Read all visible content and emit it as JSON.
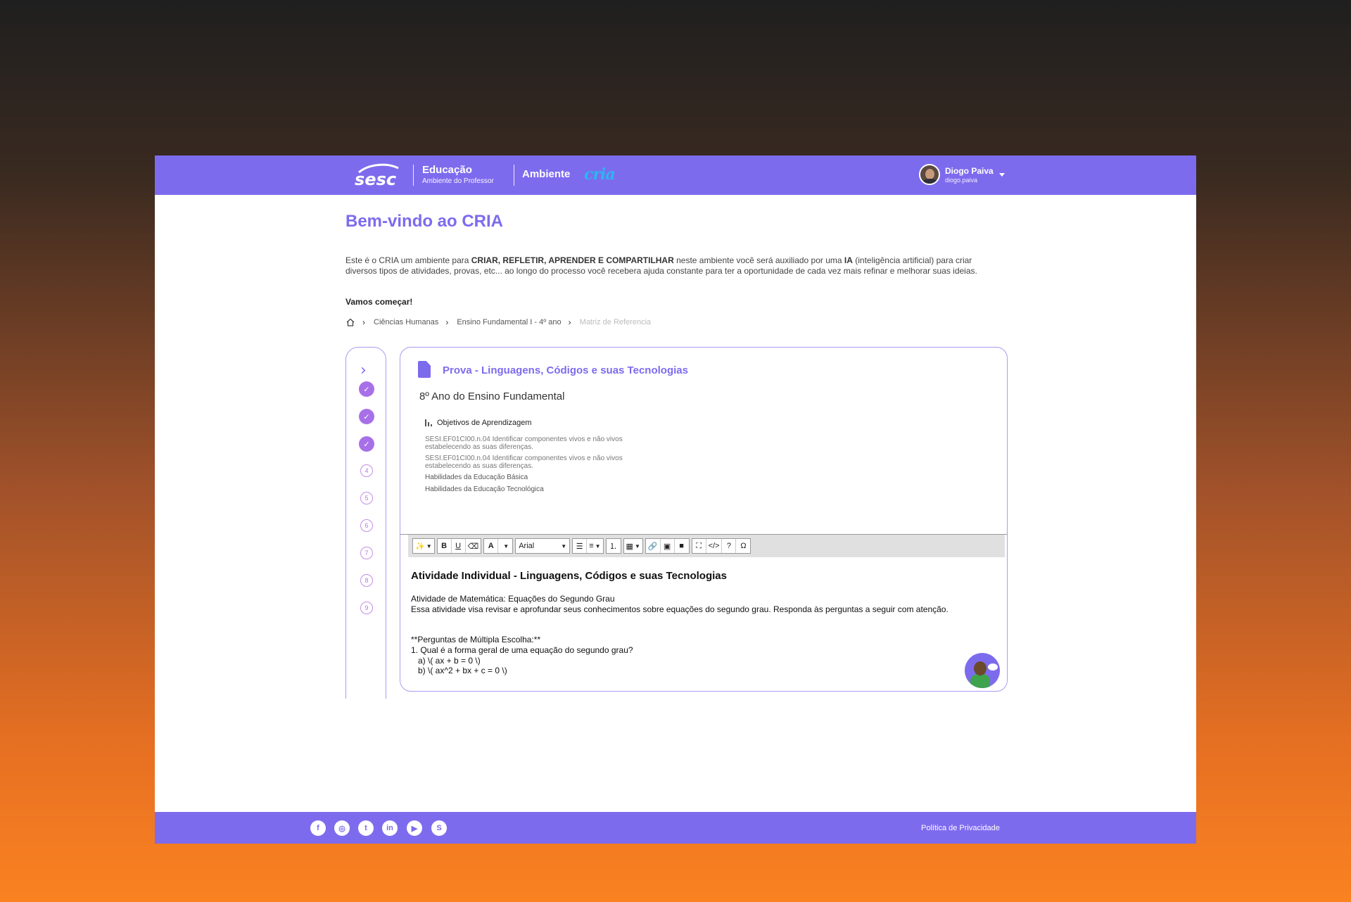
{
  "header": {
    "logo_text": "sesc",
    "section_title": "Educação",
    "section_subtitle": "Ambiente do Professor",
    "environment_label": "Ambiente",
    "environment_logo": "cria",
    "user": {
      "name": "Diogo Paiva",
      "login": "diogo.paiva"
    }
  },
  "page": {
    "title": "Bem-vindo ao CRIA",
    "intro_prefix": "Este é o CRIA um ambiente para ",
    "intro_bold_1": "CRIAR,  REFLETIR, APRENDER E COMPARTILHAR",
    "intro_mid": " neste ambiente você será auxiliado por uma ",
    "intro_bold_2": "IA",
    "intro_suffix": " (inteligência artificial) para criar diversos tipos de atividades, provas, etc... ao longo do processo você recebera ajuda constante para ter a oportunidade de cada vez mais refinar e melhorar suas ideias.",
    "start_label": "Vamos começar!"
  },
  "breadcrumb": {
    "home_icon": "home-icon",
    "items": [
      "Ciências Humanas",
      "Ensino Fundamental I - 4º ano",
      "Matriz de Referencia"
    ]
  },
  "stepper": {
    "expand_icon": "chevron-right-icon",
    "steps": [
      {
        "label": "✓",
        "state": "done"
      },
      {
        "label": "✓",
        "state": "done"
      },
      {
        "label": "✓",
        "state": "done"
      },
      {
        "label": "4",
        "state": "todo"
      },
      {
        "label": "5",
        "state": "todo"
      },
      {
        "label": "6",
        "state": "todo"
      },
      {
        "label": "7",
        "state": "todo"
      },
      {
        "label": "8",
        "state": "todo"
      },
      {
        "label": "9",
        "state": "todo"
      }
    ]
  },
  "panel": {
    "title": "Prova - Linguagens, Códigos e suas Tecnologias",
    "grade": "8º Ano do Ensino Fundamental",
    "objectives_heading": "Objetivos de Aprendizagem",
    "objectives": [
      "SESI.EF01CI00.n.04 Identificar componentes vivos e não vivos estabelecendo as suas diferenças.",
      "SESI.EF01CI00.n.04 Identificar componentes vivos e não vivos estabelecendo as suas diferenças."
    ],
    "links": [
      "Habilidades da Educação Básica",
      "Habilidades da Educação Tecnológica"
    ]
  },
  "editor": {
    "font_select": "Arial",
    "toolbar": {
      "magic": "✨",
      "bold": "B",
      "underline": "U",
      "eraser": "⌫",
      "font_color": "A",
      "bullet_list": "☰",
      "align": "≡",
      "ordered_list": "⒈",
      "table": "▦",
      "link": "🔗",
      "image": "▣",
      "video": "■",
      "fullscreen": "⛶",
      "code": "</>",
      "help": "?",
      "omega": "Ω"
    },
    "heading": "Atividade Individual - Linguagens, Códigos e suas Tecnologias",
    "lines": [
      "Atividade de Matemática: Equações do Segundo Grau",
      "Essa atividade visa revisar e aprofundar seus conhecimentos sobre equações do segundo grau. Responda às perguntas a seguir com atenção.",
      "",
      "",
      "**Perguntas de Múltipla Escolha:**",
      "1. Qual é a forma geral de uma equação do segundo grau?",
      "   a) \\( ax + b = 0 \\)",
      "   b) \\( ax^2 + bx + c = 0 \\)"
    ]
  },
  "footer": {
    "social": [
      {
        "icon": "facebook-icon",
        "glyph": "f"
      },
      {
        "icon": "instagram-icon",
        "glyph": "◎"
      },
      {
        "icon": "twitter-icon",
        "glyph": "t"
      },
      {
        "icon": "linkedin-icon",
        "glyph": "in"
      },
      {
        "icon": "youtube-icon",
        "glyph": "▶"
      },
      {
        "icon": "sesc-icon",
        "glyph": "S"
      }
    ],
    "privacy_link": "Política de Privacidade"
  },
  "colors": {
    "primary": "#7d6bee",
    "step_done": "#a870e8",
    "cria_blue": "#2bb6f0"
  }
}
